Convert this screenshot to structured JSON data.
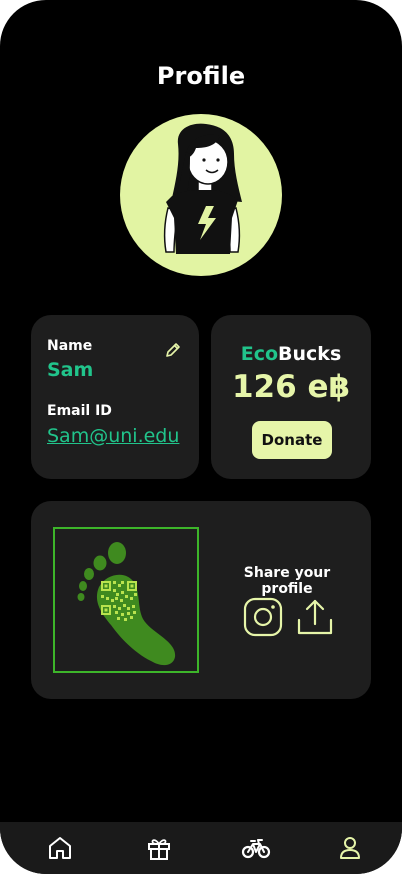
{
  "header": {
    "title": "Profile"
  },
  "profile": {
    "name_label": "Name",
    "name_value": "Sam",
    "email_label": "Email ID",
    "email_value": "Sam@uni.edu"
  },
  "ecobucks": {
    "title_part1": "Eco",
    "title_part2": "Bucks",
    "amount": "126 e฿",
    "donate_label": "Donate"
  },
  "share": {
    "title": "Share your profile"
  },
  "nav": {
    "items": [
      {
        "icon": "home-icon"
      },
      {
        "icon": "gift-icon"
      },
      {
        "icon": "bike-icon"
      },
      {
        "icon": "user-icon"
      }
    ]
  },
  "colors": {
    "background": "#000000",
    "card": "#1e1e1e",
    "accent_green": "#21c48b",
    "accent_lime": "#e6f5a9",
    "qr_green": "#3db52a"
  }
}
